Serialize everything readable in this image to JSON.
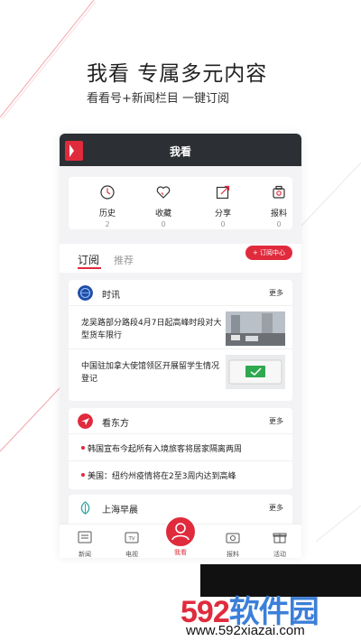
{
  "hero": {
    "title": "我看 专属多元内容",
    "subtitle": "看看号+新闻栏目 一键订阅"
  },
  "app": {
    "title": "我看",
    "quick_actions": [
      {
        "label": "历史",
        "count": "2",
        "icon": "history-icon"
      },
      {
        "label": "收藏",
        "count": "0",
        "icon": "heart-icon"
      },
      {
        "label": "分享",
        "count": "0",
        "icon": "share-icon"
      },
      {
        "label": "报料",
        "count": "0",
        "icon": "camera-icon"
      }
    ],
    "tabs": {
      "active": "订阅",
      "other": "推荐",
      "subscription_center": "+ 订阅中心"
    },
    "sections": [
      {
        "name": "时讯",
        "more": "更多",
        "items": [
          {
            "title": "龙吴路部分路段4月7日起高峰时段对大型货车限行"
          },
          {
            "title": "中国驻加拿大使馆领区开展留学生情况登记"
          }
        ]
      },
      {
        "name": "看东方",
        "more": "更多",
        "items": [
          {
            "title": "韩国宣布今起所有入境旅客将居家隔离两周"
          },
          {
            "title": "美国：纽约州疫情将在2至3周内达到高峰"
          }
        ]
      },
      {
        "name": "上海早晨",
        "more": "更多",
        "items": []
      }
    ],
    "bottom_nav": [
      {
        "label": "新闻",
        "icon": "news-icon"
      },
      {
        "label": "电视",
        "icon": "tv-icon"
      },
      {
        "label": "我看",
        "icon": "user-icon"
      },
      {
        "label": "报料",
        "icon": "camera-icon"
      },
      {
        "label": "活动",
        "icon": "gift-icon"
      }
    ]
  },
  "watermark": {
    "brand_a": "592",
    "brand_b": "软件园",
    "url": "www.592xiazai.com"
  },
  "colors": {
    "accent": "#e02b3d",
    "titlebar": "#2c2f33"
  }
}
